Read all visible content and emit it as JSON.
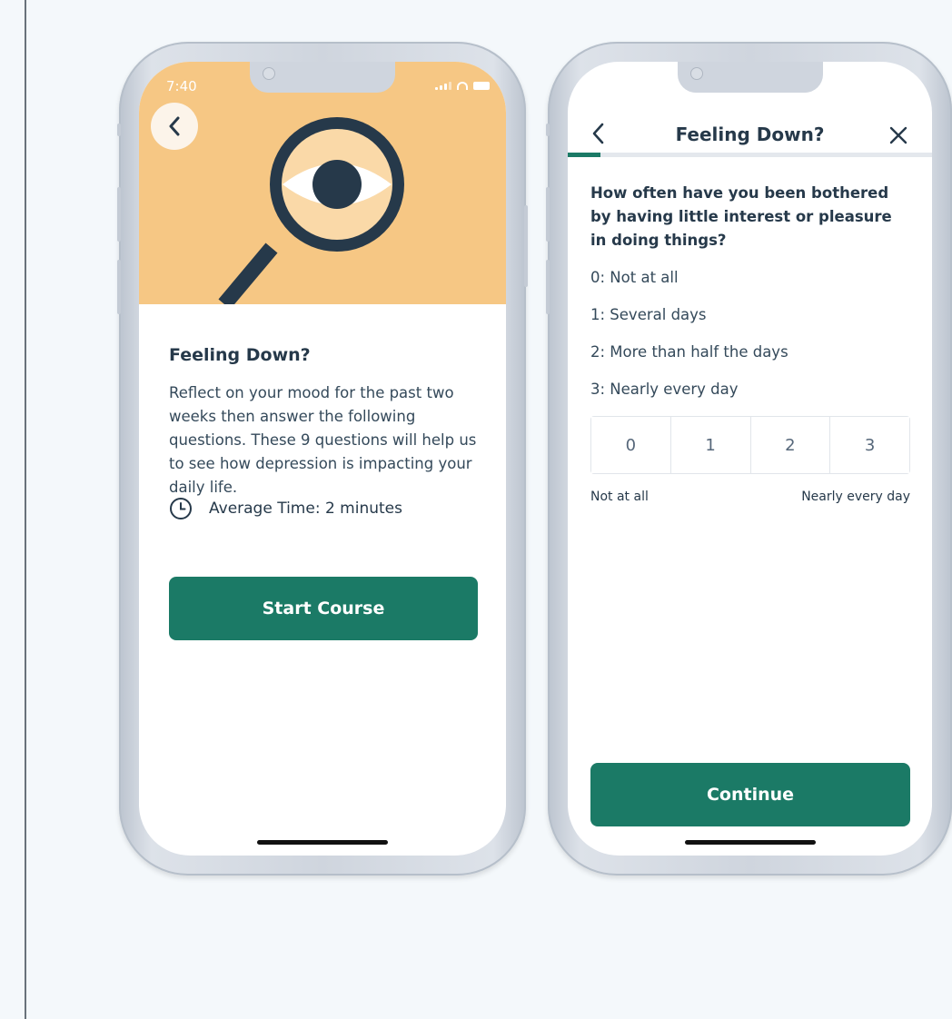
{
  "screen1": {
    "status_time": "7:40",
    "title": "Feeling Down?",
    "description": "Reflect on your mood for the past two weeks then answer the following questions. These 9 questions will help us to see how depression is impacting your daily life.",
    "average_time": "Average Time: 2 minutes",
    "start_button": "Start Course",
    "hero_color": "#f6c784",
    "icons": [
      "chevron-left-icon",
      "magnifier-eye-icon",
      "clock-icon"
    ]
  },
  "screen2": {
    "title": "Feeling Down?",
    "progress": 0.09,
    "question": "How often have you been bothered by having little interest or pleasure in doing things?",
    "options": [
      "0: Not at all",
      "1: Several days",
      "2: More than half the days",
      "3: Nearly every day"
    ],
    "scale": [
      "0",
      "1",
      "2",
      "3"
    ],
    "scale_low_label": "Not at all",
    "scale_high_label": "Nearly every day",
    "continue_button": "Continue",
    "icons": [
      "chevron-left-icon",
      "close-icon"
    ]
  },
  "colors": {
    "primary": "#1b7a66",
    "text": "#26394a",
    "background": "#f4f8fb"
  }
}
